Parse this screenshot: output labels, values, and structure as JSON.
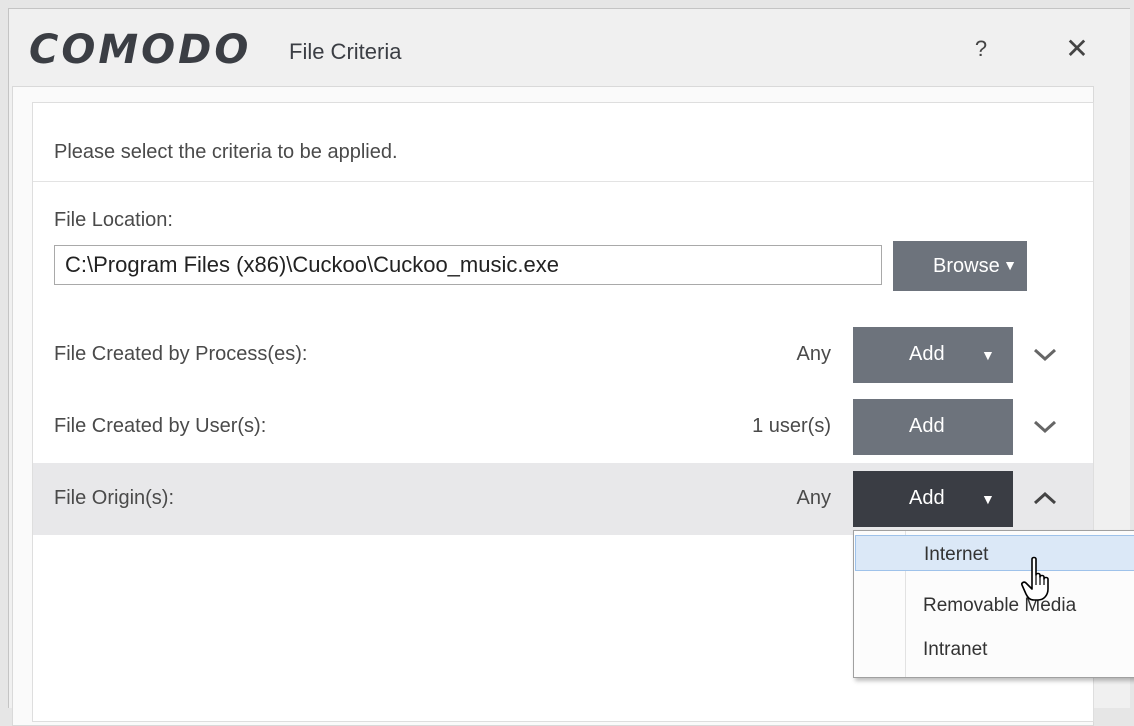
{
  "window": {
    "logo": "COMODO",
    "title": "File Criteria",
    "help_label": "?",
    "close_label": "✕"
  },
  "panel": {
    "instruction": "Please select the criteria to be applied.",
    "file_location": {
      "label": "File Location:",
      "value": "C:\\Program Files (x86)\\Cuckoo\\Cuckoo_music.exe",
      "browse_label": "Browse",
      "browse_caret": "▼"
    },
    "criteria": [
      {
        "label": "File Created by Process(es):",
        "value": "Any",
        "button": "Add",
        "caret": "▼",
        "expand": "chevron-down"
      },
      {
        "label": "File Created by User(s):",
        "value": "1 user(s)",
        "button": "Add",
        "caret": "",
        "expand": "chevron-down"
      },
      {
        "label": "File Origin(s):",
        "value": "Any",
        "button": "Add",
        "caret": "▼",
        "expand": "chevron-up"
      }
    ]
  },
  "dropdown": {
    "items": [
      "Internet",
      "Removable Media",
      "Intranet"
    ],
    "highlighted": "Internet"
  },
  "colors": {
    "button_gray": "#6d737c",
    "button_dark": "#3a3d44",
    "hover_blue": "#dbe8f7"
  }
}
